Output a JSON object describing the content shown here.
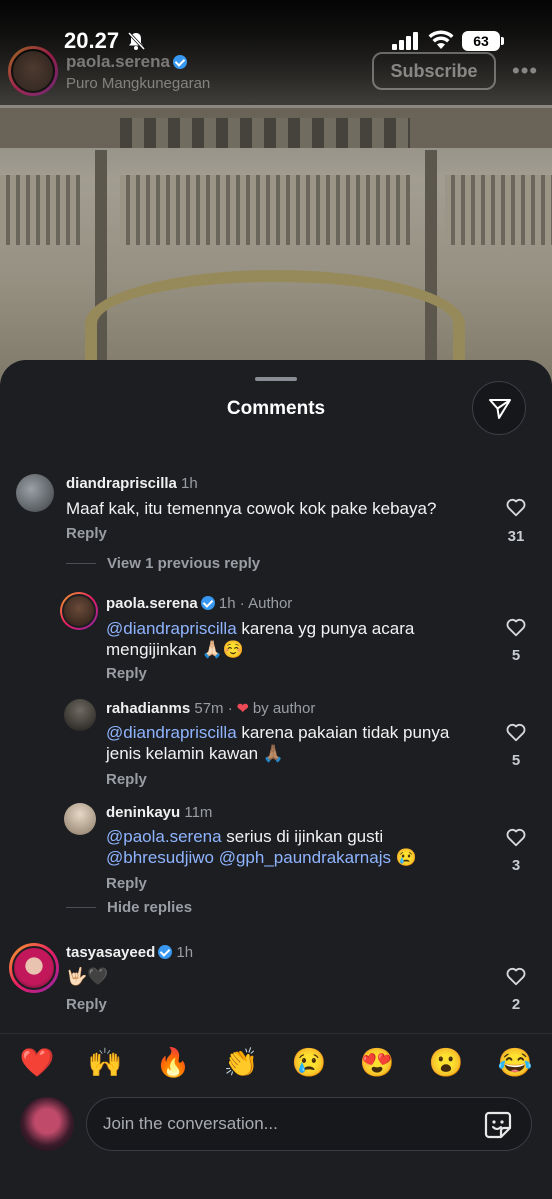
{
  "status": {
    "time": "20.27",
    "battery": "63"
  },
  "post": {
    "username": "paola.serena",
    "location": "Puro Mangkunegaran",
    "subscribe_label": "Subscribe",
    "more_label": "•••"
  },
  "sheet": {
    "title": "Comments"
  },
  "comments": [
    {
      "username": "diandrapriscilla",
      "time": "1h",
      "text": "Maaf kak, itu temennya cowok kok pake kebaya?",
      "reply_label": "Reply",
      "likes": "31",
      "view_replies": "View 1 previous reply"
    },
    {
      "username": "paola.serena",
      "time": "1h",
      "badge": "Author",
      "mention": "@diandrapriscilla",
      "text": " karena yg punya acara mengijinkan 🙏🏻☺️",
      "reply_label": "Reply",
      "likes": "5"
    },
    {
      "username": "rahadianms",
      "time": "57m",
      "liked_by": "by author",
      "mention": "@diandrapriscilla",
      "text": " karena pakaian tidak punya jenis kelamin kawan 🙏🏽",
      "reply_label": "Reply",
      "likes": "5"
    },
    {
      "username": "deninkayu",
      "time": "11m",
      "mention": "@paola.serena",
      "text_a": " serius di ijinkan gusti",
      "mention2": "@bhresudjiwo",
      "mention3": "@gph_paundrakarnajs",
      "text_b": " 😢",
      "reply_label": "Reply",
      "likes": "3",
      "hide_replies": "Hide replies"
    },
    {
      "username": "tasyasayeed",
      "time": "1h",
      "text": "🤟🏻🖤",
      "reply_label": "Reply",
      "likes": "2"
    }
  ],
  "emojis": [
    "❤️",
    "🙌",
    "🔥",
    "👏",
    "😢",
    "😍",
    "😮",
    "😂"
  ],
  "composer": {
    "placeholder": "Join the conversation..."
  },
  "colors": {
    "sheet_bg": "#1c1e22",
    "mention": "#8fb4ff",
    "verified": "#3897f0",
    "like_heart": "#ed4956"
  }
}
